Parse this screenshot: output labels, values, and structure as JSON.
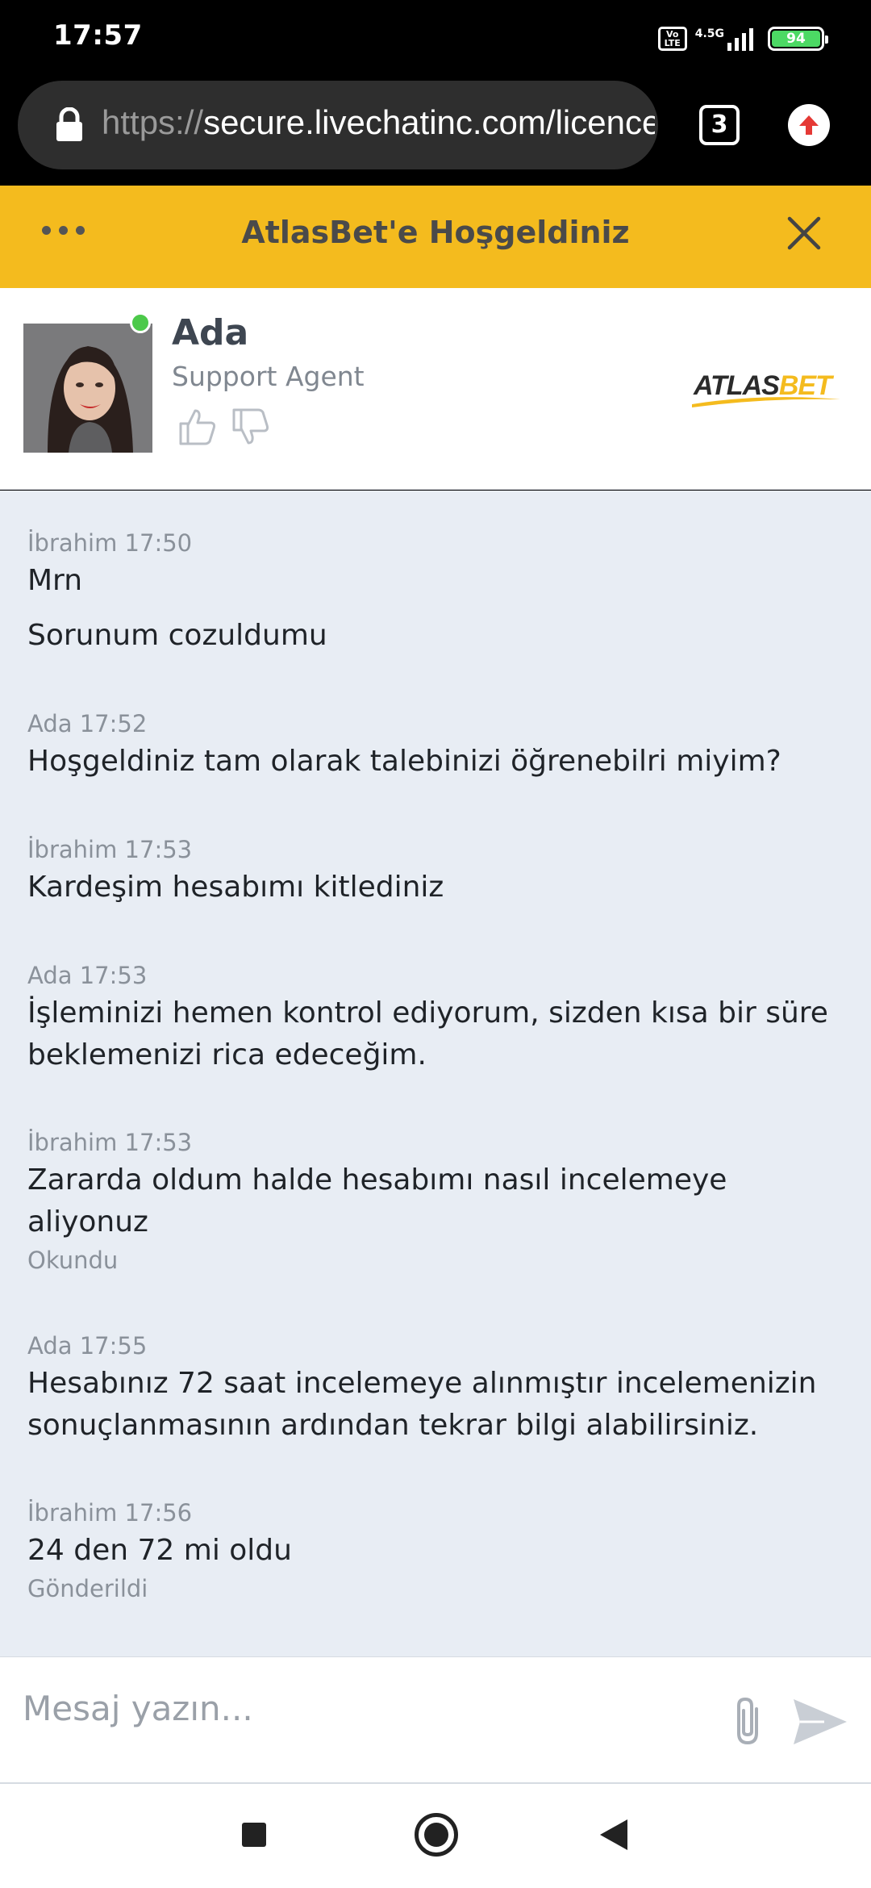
{
  "status_bar": {
    "time": "17:57",
    "volte_label_top": "Vo",
    "volte_label_bottom": "LTE",
    "network": "4.5G",
    "battery": "94"
  },
  "browser": {
    "url_scheme": "https://",
    "url_rest": "secure.livechatinc.com/licence",
    "tab_count": "3"
  },
  "chat_header": {
    "title": "AtlasBet'e Hoşgeldiniz"
  },
  "agent": {
    "name": "Ada",
    "role": "Support Agent",
    "brand": "ATLASBET",
    "online_color": "#4cc94a"
  },
  "messages": [
    {
      "meta": "İbrahim 17:50",
      "texts": [
        "Mrn",
        "Sorunum cozuldumu"
      ],
      "status": ""
    },
    {
      "meta": "Ada 17:52",
      "texts": [
        "Hoşgeldiniz tam olarak talebinizi öğrenebilri miyim?"
      ],
      "status": ""
    },
    {
      "meta": "İbrahim 17:53",
      "texts": [
        "Kardeşim hesabımı kitlediniz"
      ],
      "status": ""
    },
    {
      "meta": "Ada 17:53",
      "texts": [
        "İşleminizi hemen kontrol ediyorum, sizden kısa bir süre beklemenizi rica edeceğim."
      ],
      "status": ""
    },
    {
      "meta": "İbrahim 17:53",
      "texts": [
        "Zararda oldum halde hesabımı nasıl incelemeye aliyonuz"
      ],
      "status": "Okundu"
    },
    {
      "meta": "Ada 17:55",
      "texts": [
        "Hesabınız 72 saat incelemeye alınmıştır incelemenizin sonuçlanmasının ardından tekrar bilgi alabilirsiniz."
      ],
      "status": ""
    },
    {
      "meta": "İbrahim 17:56",
      "texts": [
        "24 den 72 mi oldu"
      ],
      "status": "Gönderildi"
    }
  ],
  "composer": {
    "placeholder": "Mesaj yazın..."
  },
  "colors": {
    "header_yellow": "#f4bb1e",
    "chat_bg": "#e8edf4"
  }
}
